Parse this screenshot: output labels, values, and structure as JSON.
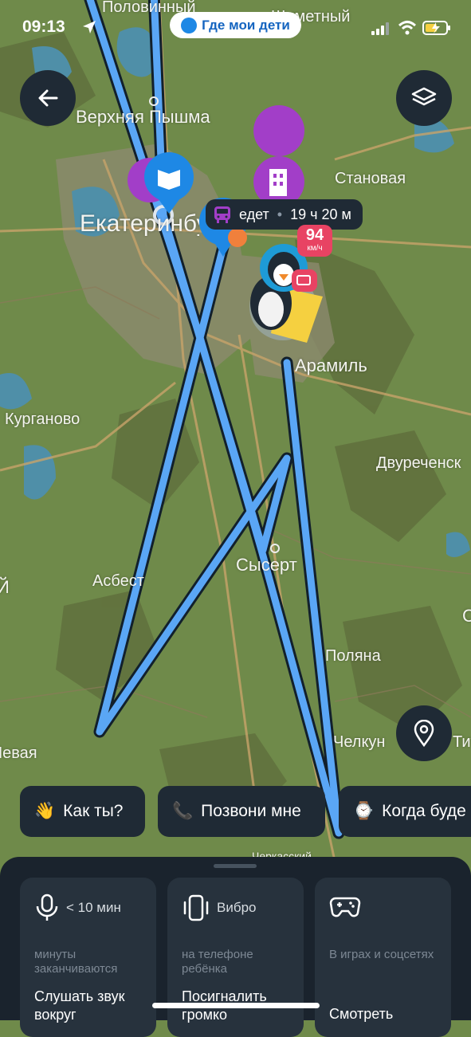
{
  "status_bar": {
    "time": "09:13",
    "app_name": "Где мои дети"
  },
  "map": {
    "labels": [
      "Половинный",
      "Шиметный",
      "Верхняя Пышма",
      "Становая",
      "Екатеринбург",
      "Арамиль",
      "Курганово",
      "Двуреченск",
      "Асбест",
      "Сысерт",
      "Поляна",
      "Челкун",
      "Тит",
      "Левая",
      "Черкасский",
      "Й",
      "С"
    ]
  },
  "tooltip": {
    "status": "едет",
    "duration": "19 ч 20 м"
  },
  "speed": {
    "value": "94",
    "unit": "км/ч"
  },
  "chips": [
    {
      "emoji": "👋",
      "label": "Как ты?"
    },
    {
      "emoji": "📞",
      "label": "Позвони мне"
    },
    {
      "emoji": "⌚",
      "label": "Когда буде"
    }
  ],
  "cards": [
    {
      "top": "< 10 мин",
      "sub": "минуты заканчиваются",
      "action": "Слушать звук вокруг",
      "icon": "microphone-icon"
    },
    {
      "top": "Вибро",
      "sub": "на телефоне ребёнка",
      "action": "Посигналить громко",
      "icon": "phone-vibrate-icon"
    },
    {
      "top": "",
      "sub": "В играх и соцсетях",
      "action": "Смотреть",
      "icon": "gamepad-icon"
    }
  ],
  "colors": {
    "track": "#5aa6f5",
    "panel": "#1f2a35",
    "accent_purple": "#a23ec8",
    "accent_blue": "#1e88e5",
    "speed_badge": "#e84363"
  }
}
